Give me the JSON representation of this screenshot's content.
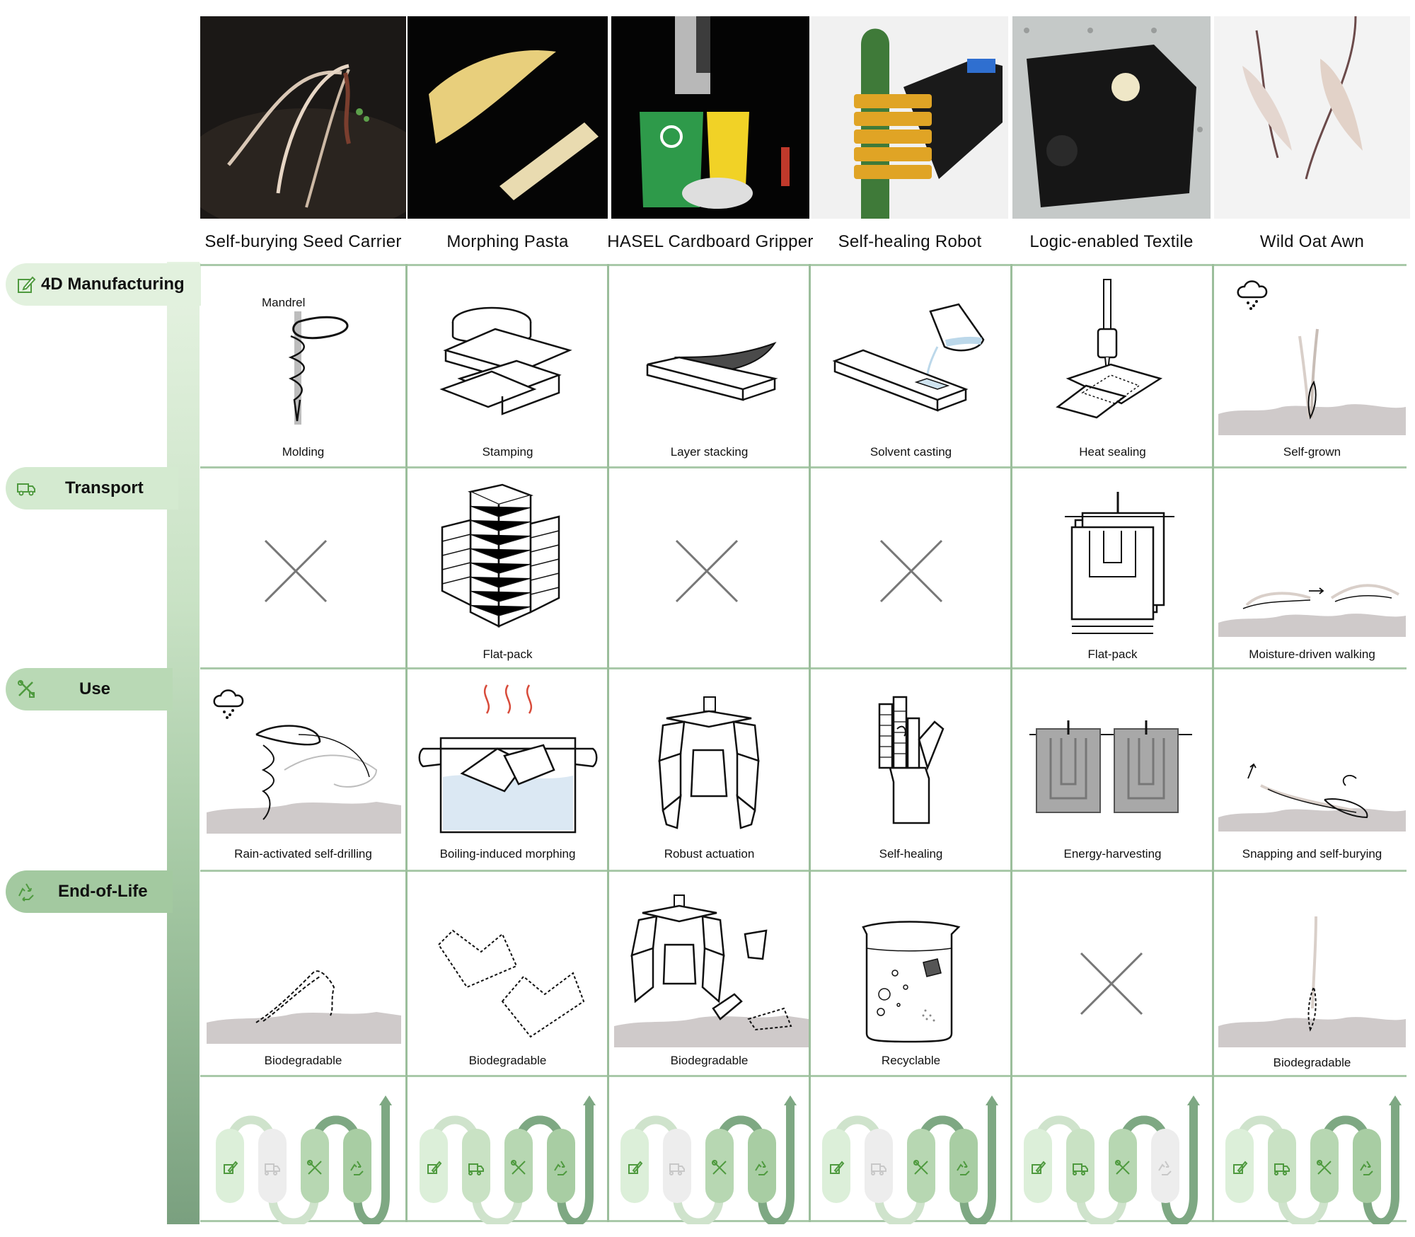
{
  "columns": [
    {
      "title": "Self-burying Seed Carrier"
    },
    {
      "title": "Morphing Pasta"
    },
    {
      "title": "HASEL Cardboard Gripper"
    },
    {
      "title": "Self-healing Robot"
    },
    {
      "title": "Logic-enabled Textile"
    },
    {
      "title": "Wild Oat Awn"
    }
  ],
  "stages": [
    {
      "label": "4D Manufacturing",
      "icon": "edit-square-icon"
    },
    {
      "label": "Transport",
      "icon": "truck-icon"
    },
    {
      "label": "Use",
      "icon": "tools-icon"
    },
    {
      "label": "End-of-Life",
      "icon": "recycle-icon"
    }
  ],
  "annotations": {
    "mandrel": "Mandrel"
  },
  "cells": {
    "manufacturing": [
      "Molding",
      "Stamping",
      "Layer stacking",
      "Solvent casting",
      "Heat sealing",
      "Self-grown"
    ],
    "transport": [
      "",
      "Flat-pack",
      "",
      "",
      "Flat-pack",
      "Moisture-driven walking"
    ],
    "use": [
      "Rain-activated self-drilling",
      "Boiling-induced morphing",
      "Robust actuation",
      "Self-healing",
      "Energy-harvesting",
      "Snapping and self-burying"
    ],
    "end_of_life": [
      "Biodegradable",
      "Biodegradable",
      "Biodegradable",
      "Recyclable",
      "",
      "Biodegradable"
    ]
  },
  "lifecycle_active": [
    [
      true,
      false,
      true,
      true
    ],
    [
      true,
      true,
      true,
      true
    ],
    [
      true,
      false,
      true,
      true
    ],
    [
      true,
      false,
      true,
      true
    ],
    [
      true,
      true,
      true,
      false
    ],
    [
      true,
      true,
      true,
      true
    ]
  ],
  "colors": {
    "accent_green": "#5f9a5f",
    "light_green": "#dcefd9",
    "grid": "#a9c9a9",
    "dark_green": "#6f9a75"
  }
}
